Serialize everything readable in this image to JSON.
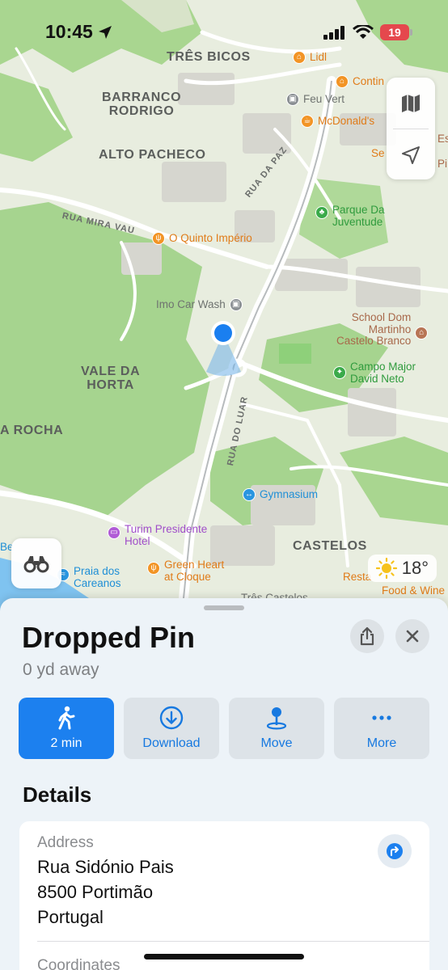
{
  "status_bar": {
    "time": "10:45",
    "battery": "19"
  },
  "map": {
    "areas": {
      "tres_bicos": "TRÊS BICOS",
      "barranco_rodrigo": "BARRANCO\nRODRIGO",
      "alto_pacheco": "ALTO PACHECO",
      "vale_da_horta": "VALE DA\nHORTA",
      "a_rocha": "A ROCHA",
      "castelos": "CASTELOS"
    },
    "streets": {
      "rua_mira_vau": "RUA MIRA VAU",
      "rua_da_paz": "RUA DA PAZ",
      "rua_do_luar": "RUA DO LUAR"
    },
    "pois": {
      "lidl": "Lidl",
      "continente": "Contin",
      "feu_vert": "Feu Vert",
      "mcdonalds": "McDonald's",
      "es": "Es",
      "pi": "Pi",
      "se": "Se",
      "parque": "Parque Da\nJuventude",
      "quinto": "O Quinto Império",
      "imo": "Imo Car Wash",
      "school": "School Dom\nMartinho\nCastelo Branco",
      "campo": "Campo Major\nDavid Neto",
      "gymnasium": "Gymnasium",
      "turim": "Turim Presidente\nHotel",
      "green_heart": "Green Heart\nat Cloque",
      "praia": "Praia dos\nCareanos",
      "resta": "Resta",
      "food_wine": "Food & Wine",
      "tres_castelos": "Três Castelos",
      "be": "Be"
    },
    "weather": {
      "temp": "18°",
      "icon": "sun-icon"
    }
  },
  "sheet": {
    "title": "Dropped Pin",
    "subtitle": "0 yd away",
    "actions": [
      {
        "label": "2 min",
        "icon": "walk-icon"
      },
      {
        "label": "Download",
        "icon": "download-icon"
      },
      {
        "label": "Move",
        "icon": "pin-icon"
      },
      {
        "label": "More",
        "icon": "ellipsis-icon"
      }
    ],
    "details_heading": "Details",
    "address_label": "Address",
    "address_lines": [
      "Rua Sidónio Pais",
      "8500 Portimão",
      "Portugal"
    ],
    "coordinates_label": "Coordinates"
  },
  "colors": {
    "accent": "#1c80ef",
    "map_green": "#a6d48f",
    "map_bg": "#e8eddf",
    "location_blue": "#1a7ff0"
  }
}
